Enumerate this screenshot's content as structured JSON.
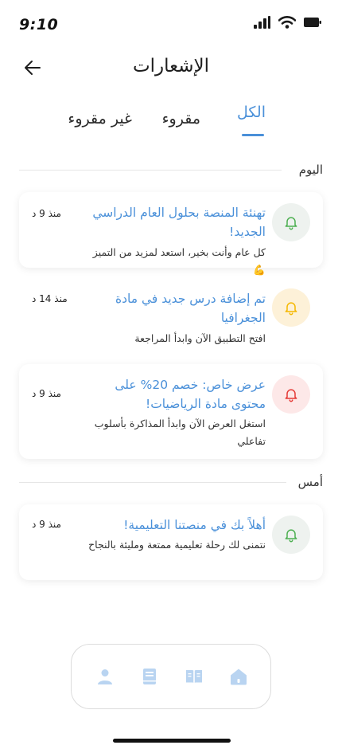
{
  "status_bar": {
    "time": "9:10"
  },
  "header": {
    "title": "الإشعارات"
  },
  "tabs": [
    {
      "label": "الكل",
      "active": true
    },
    {
      "label": "مقروء",
      "active": false
    },
    {
      "label": "غير مقروء",
      "active": false
    }
  ],
  "sections": [
    {
      "label": "اليوم",
      "notifications": [
        {
          "title": "تهنئة المنصة بحلول العام الدراسي الجديد!",
          "body": "كل عام وأنت بخير، استعد لمزيد من التميز 💪",
          "time": "منذ 9 د",
          "icon": "bell-icon",
          "icon_color": "#4caf50",
          "bg_color": "#eef2ef"
        },
        {
          "title": "تم إضافة درس جديد في مادة الجغرافيا",
          "body": "افتح التطبيق الآن وابدأ المراجعة",
          "time": "منذ 14 د",
          "icon": "bell-icon",
          "icon_color": "#f5b800",
          "bg_color": "#fdf1d8"
        },
        {
          "title": "عرض خاص: خصم 20% على محتوى مادة الرياضيات!",
          "body": "استغل العرض الآن وابدأ المذاكرة بأسلوب تفاعلي",
          "time": "منذ 9 د",
          "icon": "bell-icon",
          "icon_color": "#e53935",
          "bg_color": "#fde8e8"
        }
      ]
    },
    {
      "label": "أمس",
      "notifications": [
        {
          "title": "أهلاً بك في منصتنا التعليمية!",
          "body": "نتمنى لك رحلة تعليمية ممتعة ومليئة بالنجاح",
          "time": "منذ 9 د",
          "icon": "bell-icon",
          "icon_color": "#4caf50",
          "bg_color": "#eef2ef"
        }
      ]
    }
  ],
  "bottom_nav": [
    {
      "icon": "home-icon",
      "active": true
    },
    {
      "icon": "open-book-icon",
      "active": false
    },
    {
      "icon": "book-icon",
      "active": false
    },
    {
      "icon": "profile-icon",
      "active": false
    }
  ],
  "colors": {
    "accent": "#4a90d9",
    "nav_icon": "#b9d4f1"
  }
}
